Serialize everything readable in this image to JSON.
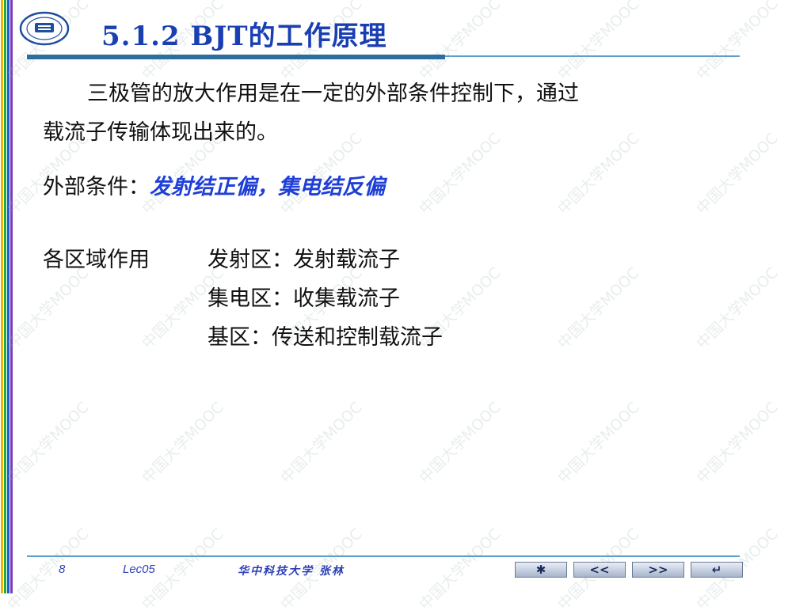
{
  "colors": {
    "title": "#1a3fb3",
    "emphasis": "#1f3fd6",
    "rule": "#5aa0c8",
    "stripes": [
      "#f2b400",
      "#1fa84a",
      "#1c5fd1",
      "#7a3fb8"
    ]
  },
  "header": {
    "title": "5.1.2  BJT的工作原理"
  },
  "body": {
    "para_line1": "三极管的放大作用是在一定的外部条件控制下，通过",
    "para_line2": "载流子传输体现出来的。",
    "condition_label": "外部条件：",
    "condition_value": "发射结正偏，集电结反偏",
    "regions_label": "各区域作用",
    "regions": [
      "发射区：发射载流子",
      "集电区：收集载流子",
      "基区：传送和控制载流子"
    ]
  },
  "watermark": {
    "text": "中国大学MOOC"
  },
  "footer": {
    "page": "8",
    "lecture": "Lec05",
    "school_author": "华中科技大学  张林",
    "nav_buttons": [
      {
        "icon": "asterisk-icon",
        "glyph": "✱"
      },
      {
        "icon": "double-chevron-left-icon",
        "glyph": "<<"
      },
      {
        "icon": "double-chevron-right-icon",
        "glyph": ">>"
      },
      {
        "icon": "return-arrow-icon",
        "glyph": "↵"
      }
    ]
  }
}
